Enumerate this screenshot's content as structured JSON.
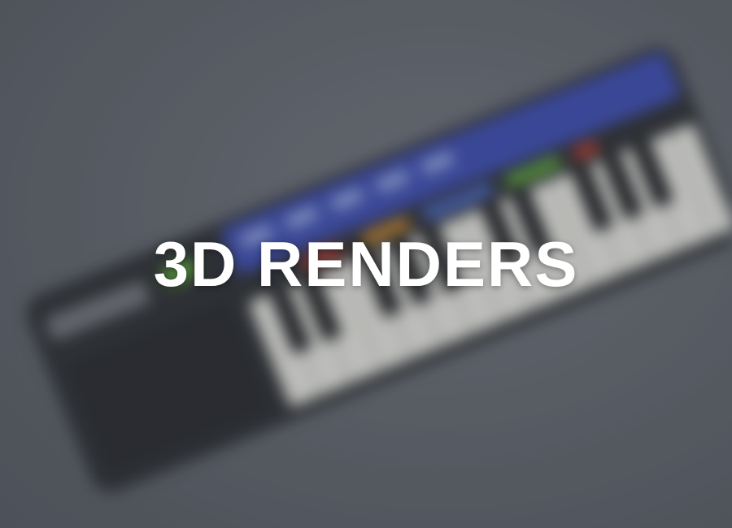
{
  "banner": {
    "title": "3D RENDERS"
  },
  "background": {
    "subject": "keyboard-icon",
    "colors": {
      "backdrop": "#5d6169",
      "body": "#2b2d31",
      "panel": "#3a49a8",
      "keys_white": "#d9d9d4",
      "keys_black": "#1d1e21",
      "accent_green": "#5fae3a",
      "accent_orange": "#d08a2a",
      "accent_red": "#c0392b"
    }
  }
}
